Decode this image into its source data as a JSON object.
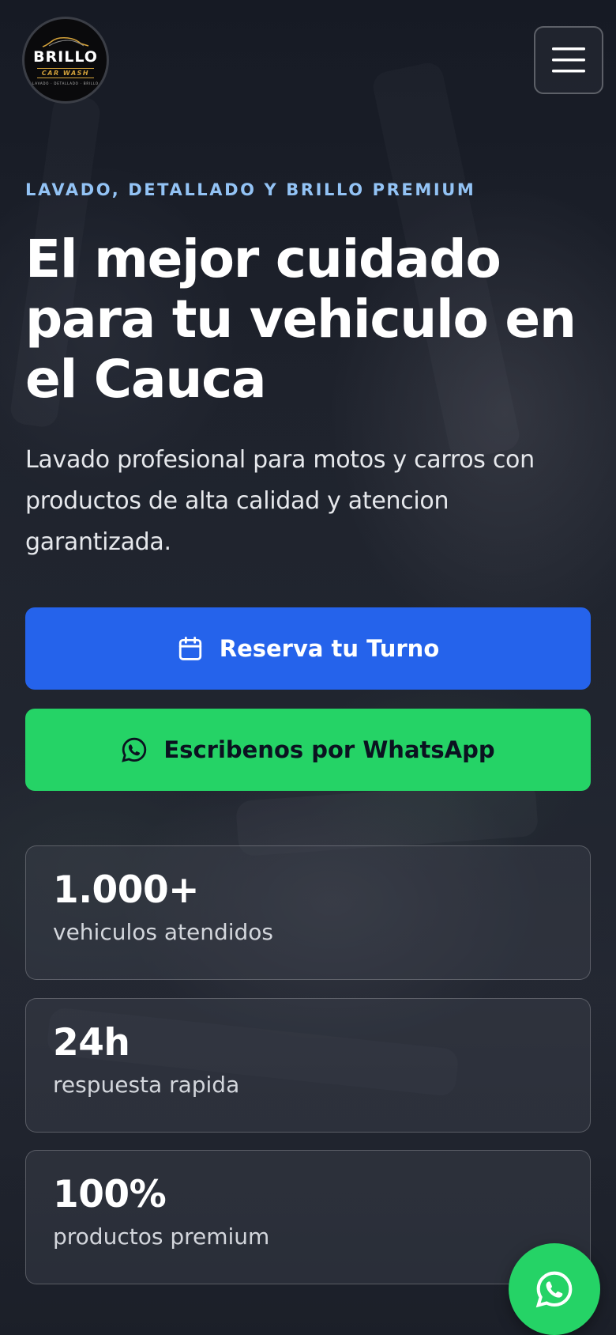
{
  "header": {
    "logo": {
      "brand": "BRILLO",
      "sub": "CAR WASH",
      "tagline": "LAVADO · DETALLADO · BRILLO"
    },
    "menu_icon": "hamburger-menu-icon"
  },
  "hero": {
    "eyebrow": "LAVADO, DETALLADO Y BRILLO PREMIUM",
    "headline": "El mejor cuidado para tu vehiculo en el Cauca",
    "description": "Lavado profesional para motos y carros con productos de alta calidad y atencion garantizada."
  },
  "buttons": {
    "reserve": {
      "label": "Reserva tu Turno",
      "icon": "calendar-icon",
      "color": "#2563eb"
    },
    "whatsapp": {
      "label": "Escribenos por WhatsApp",
      "icon": "whatsapp-icon",
      "color": "#25d366"
    }
  },
  "stats": [
    {
      "value": "1.000+",
      "label": "vehiculos atendidos"
    },
    {
      "value": "24h",
      "label": "respuesta rapida"
    },
    {
      "value": "100%",
      "label": "productos premium"
    }
  ],
  "floating_button": {
    "icon": "whatsapp-icon",
    "color": "#25d366"
  },
  "colors": {
    "accent_text": "#93c3f5",
    "brand_gold": "#d4a23a"
  }
}
